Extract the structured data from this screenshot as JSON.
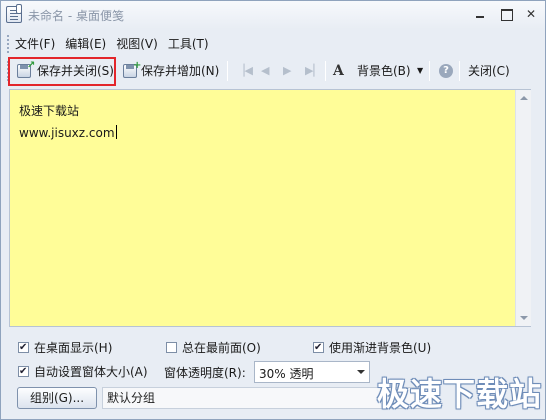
{
  "window": {
    "title": "未命名 - 桌面便笺"
  },
  "menu": {
    "items": [
      {
        "label": "文件(F)"
      },
      {
        "label": "编辑(E)"
      },
      {
        "label": "视图(V)"
      },
      {
        "label": "工具(T)"
      }
    ]
  },
  "toolbar": {
    "save_close_label": "保存并关闭(S)",
    "save_add_label": "保存并增加(N)",
    "font_label": "A",
    "bg_color_label": "背景色(B)",
    "help_label": "?",
    "close_label": "关闭(C)"
  },
  "note": {
    "lines": [
      "极速下载站",
      "www.jisuxz.com"
    ],
    "background_color": "#fffd98"
  },
  "options": {
    "show_on_desktop": {
      "label": "在桌面显示(H)",
      "checked": true
    },
    "always_on_top": {
      "label": "总在最前面(O)",
      "checked": false
    },
    "use_gradient_bg": {
      "label": "使用渐进背景色(U)",
      "checked": true
    },
    "auto_size": {
      "label": "自动设置窗体大小(A)",
      "checked": true
    },
    "transparency_label": "窗体透明度(R):",
    "transparency_value": "30% 透明"
  },
  "group": {
    "button_label": "组别(G)...",
    "value": "默认分组"
  },
  "watermark": "极速下载站",
  "colors": {
    "highlight": "#e3262b",
    "note_background": "#fffd98"
  }
}
